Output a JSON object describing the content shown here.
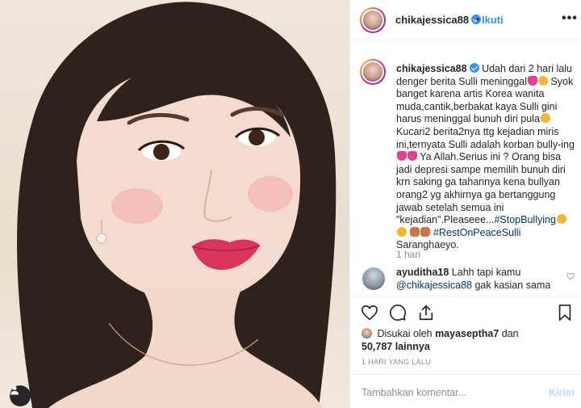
{
  "header": {
    "username": "chikajessica88",
    "separator": "•",
    "follow_label": "Ikuti",
    "more_label": "•••"
  },
  "caption": {
    "username": "chikajessica88",
    "part1": "Udah dari 2 hari lalu denger berita Sulli meninggal",
    "part2": "Syok banget karena artis Korea wanita muda,cantik,berbakat kaya Sulli gini harus meninggal bunuh diri pula",
    "part3": "Kucari2 berita2nya ttg kejadian miris ini,ternyata Sulli adalah korban bully-ing",
    "part4": "Ya Allah.Serius ini ? Orang bisa jadi depresi sampe memilih bunuh diri krn saking ga tahannya kena bullyan orang2 yg akhirnya ga bertanggung jawab setelah semua ini \"kejadian\".Pleaseee...",
    "hashtag1": "#StopBullying",
    "hashtag2": "#RestOnPeaceSulli",
    "part5": "Saranghaeyo.",
    "time": "1 hari"
  },
  "comment": {
    "username": "ayuditha18",
    "text_before": "Lahh tapi kamu",
    "mention": "@chikajessica88",
    "text_after": "gak kasian sama"
  },
  "actions": {
    "like_icon": "heart-icon",
    "comment_icon": "comment-icon",
    "share_icon": "share-icon",
    "save_icon": "bookmark-icon"
  },
  "likes": {
    "prefix": "Disukai oleh",
    "liker": "mayaseptha7",
    "conjunction": "dan",
    "count": "50,787 lainnya"
  },
  "timestamp": "1 HARI YANG LALU",
  "add_comment": {
    "placeholder": "Tambahkan komentar...",
    "post_label": "Kirim"
  },
  "colors": {
    "link_blue": "#3897f0",
    "text": "#262626",
    "muted": "#8e8e8e",
    "hashtag": "#003569",
    "post_disabled": "#b2dffc"
  }
}
